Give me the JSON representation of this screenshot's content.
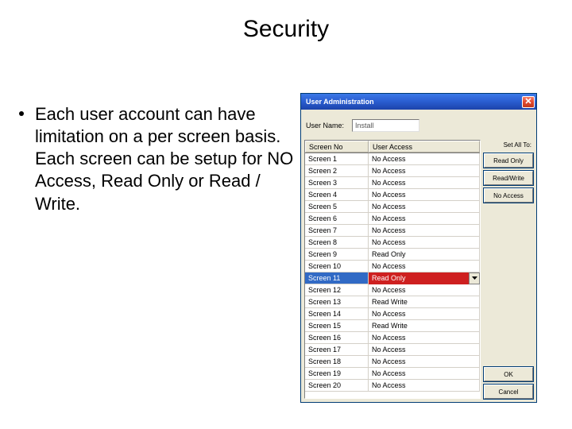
{
  "slide": {
    "title": "Security",
    "bullet": "Each user account can have limitation on a per screen basis.  Each screen can be setup for NO Access, Read Only or Read / Write."
  },
  "window": {
    "title": "User Administration",
    "user_name_label": "User Name:",
    "user_name_value": "Install",
    "set_all_label": "Set All To:",
    "columns": {
      "c0": "Screen No",
      "c1": "User Access"
    },
    "rows": [
      {
        "no": "Screen 1",
        "ua": "No Access"
      },
      {
        "no": "Screen 2",
        "ua": "No Access"
      },
      {
        "no": "Screen 3",
        "ua": "No Access"
      },
      {
        "no": "Screen 4",
        "ua": "No Access"
      },
      {
        "no": "Screen 5",
        "ua": "No Access"
      },
      {
        "no": "Screen 6",
        "ua": "No Access"
      },
      {
        "no": "Screen 7",
        "ua": "No Access"
      },
      {
        "no": "Screen 8",
        "ua": "No Access"
      },
      {
        "no": "Screen 9",
        "ua": "Read Only"
      },
      {
        "no": "Screen 10",
        "ua": "No Access"
      },
      {
        "no": "Screen 11",
        "ua": "Read Only",
        "selected": true
      },
      {
        "no": "Screen 12",
        "ua": "No Access"
      },
      {
        "no": "Screen 13",
        "ua": "Read Write"
      },
      {
        "no": "Screen 14",
        "ua": "No Access"
      },
      {
        "no": "Screen 15",
        "ua": "Read Write"
      },
      {
        "no": "Screen 16",
        "ua": "No Access"
      },
      {
        "no": "Screen 17",
        "ua": "No Access"
      },
      {
        "no": "Screen 18",
        "ua": "No Access"
      },
      {
        "no": "Screen 19",
        "ua": "No Access"
      },
      {
        "no": "Screen 20",
        "ua": "No Access"
      }
    ],
    "buttons": {
      "read_only": "Read Only",
      "read_write": "Read/Write",
      "no_access": "No Access",
      "ok": "OK",
      "cancel": "Cancel"
    }
  }
}
